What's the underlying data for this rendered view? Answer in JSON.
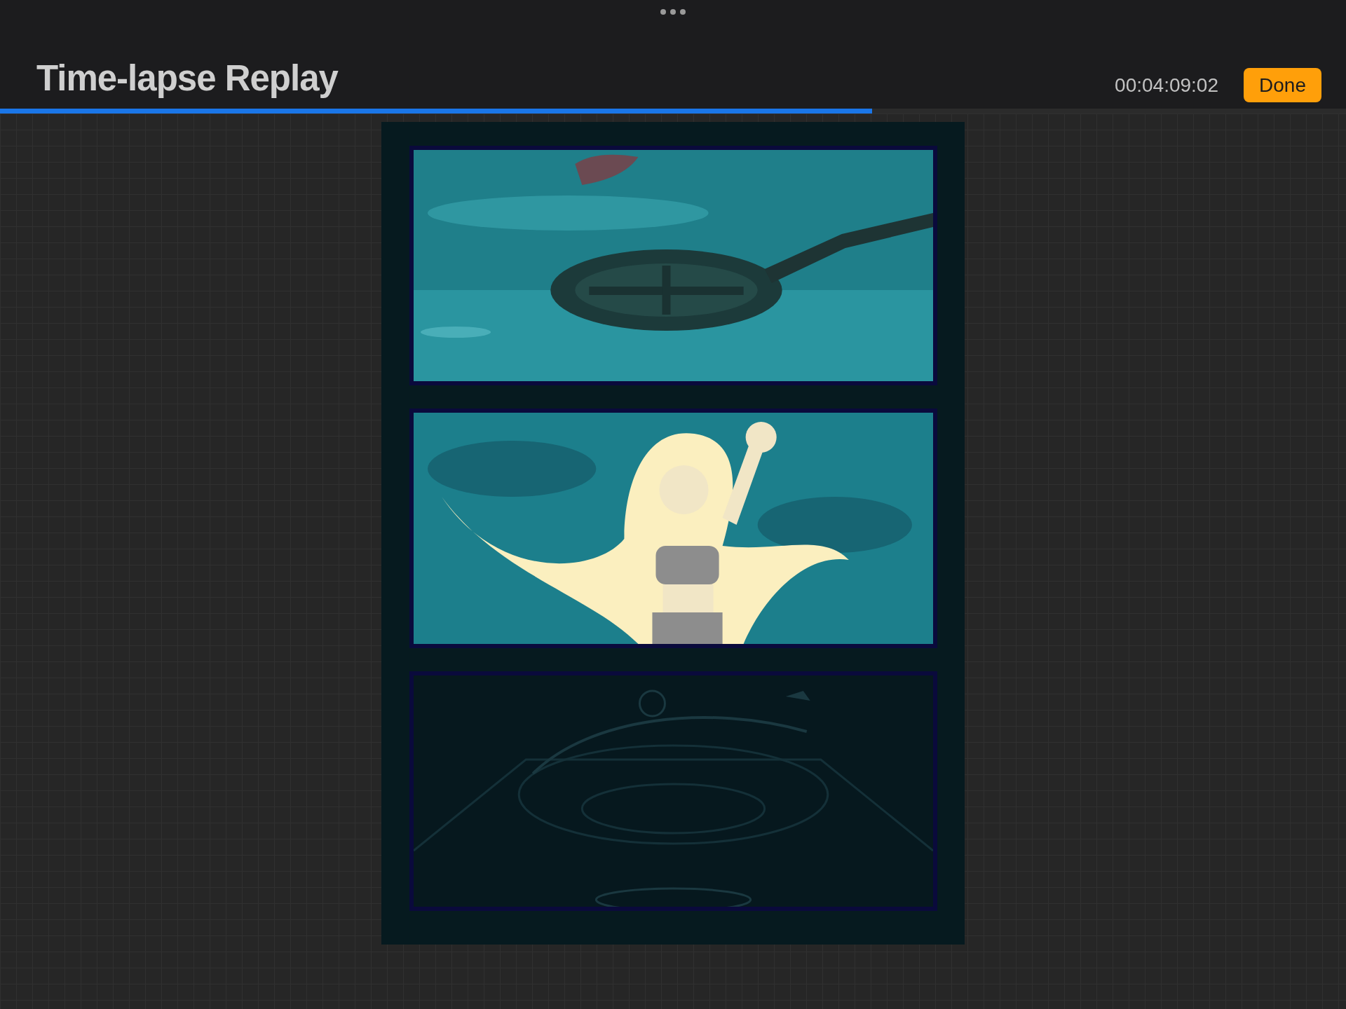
{
  "header": {
    "title": "Time-lapse Replay",
    "time": "00:04:09:02",
    "done_button": "Done"
  },
  "progress": {
    "level": 0.648
  }
}
